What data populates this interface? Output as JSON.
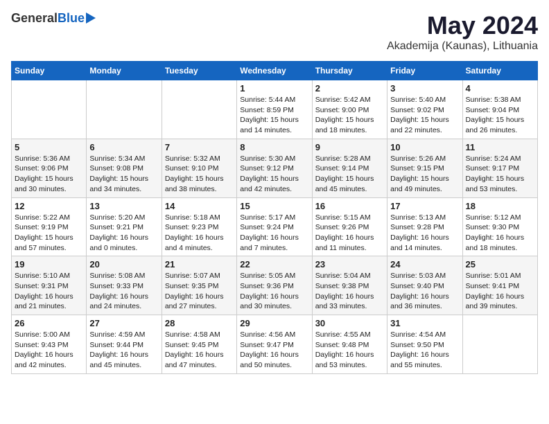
{
  "header": {
    "logo_general": "General",
    "logo_blue": "Blue",
    "month_year": "May 2024",
    "location": "Akademija (Kaunas), Lithuania"
  },
  "days_of_week": [
    "Sunday",
    "Monday",
    "Tuesday",
    "Wednesday",
    "Thursday",
    "Friday",
    "Saturday"
  ],
  "weeks": [
    [
      {
        "day": "",
        "info": ""
      },
      {
        "day": "",
        "info": ""
      },
      {
        "day": "",
        "info": ""
      },
      {
        "day": "1",
        "info": "Sunrise: 5:44 AM\nSunset: 8:59 PM\nDaylight: 15 hours\nand 14 minutes."
      },
      {
        "day": "2",
        "info": "Sunrise: 5:42 AM\nSunset: 9:00 PM\nDaylight: 15 hours\nand 18 minutes."
      },
      {
        "day": "3",
        "info": "Sunrise: 5:40 AM\nSunset: 9:02 PM\nDaylight: 15 hours\nand 22 minutes."
      },
      {
        "day": "4",
        "info": "Sunrise: 5:38 AM\nSunset: 9:04 PM\nDaylight: 15 hours\nand 26 minutes."
      }
    ],
    [
      {
        "day": "5",
        "info": "Sunrise: 5:36 AM\nSunset: 9:06 PM\nDaylight: 15 hours\nand 30 minutes."
      },
      {
        "day": "6",
        "info": "Sunrise: 5:34 AM\nSunset: 9:08 PM\nDaylight: 15 hours\nand 34 minutes."
      },
      {
        "day": "7",
        "info": "Sunrise: 5:32 AM\nSunset: 9:10 PM\nDaylight: 15 hours\nand 38 minutes."
      },
      {
        "day": "8",
        "info": "Sunrise: 5:30 AM\nSunset: 9:12 PM\nDaylight: 15 hours\nand 42 minutes."
      },
      {
        "day": "9",
        "info": "Sunrise: 5:28 AM\nSunset: 9:14 PM\nDaylight: 15 hours\nand 45 minutes."
      },
      {
        "day": "10",
        "info": "Sunrise: 5:26 AM\nSunset: 9:15 PM\nDaylight: 15 hours\nand 49 minutes."
      },
      {
        "day": "11",
        "info": "Sunrise: 5:24 AM\nSunset: 9:17 PM\nDaylight: 15 hours\nand 53 minutes."
      }
    ],
    [
      {
        "day": "12",
        "info": "Sunrise: 5:22 AM\nSunset: 9:19 PM\nDaylight: 15 hours\nand 57 minutes."
      },
      {
        "day": "13",
        "info": "Sunrise: 5:20 AM\nSunset: 9:21 PM\nDaylight: 16 hours\nand 0 minutes."
      },
      {
        "day": "14",
        "info": "Sunrise: 5:18 AM\nSunset: 9:23 PM\nDaylight: 16 hours\nand 4 minutes."
      },
      {
        "day": "15",
        "info": "Sunrise: 5:17 AM\nSunset: 9:24 PM\nDaylight: 16 hours\nand 7 minutes."
      },
      {
        "day": "16",
        "info": "Sunrise: 5:15 AM\nSunset: 9:26 PM\nDaylight: 16 hours\nand 11 minutes."
      },
      {
        "day": "17",
        "info": "Sunrise: 5:13 AM\nSunset: 9:28 PM\nDaylight: 16 hours\nand 14 minutes."
      },
      {
        "day": "18",
        "info": "Sunrise: 5:12 AM\nSunset: 9:30 PM\nDaylight: 16 hours\nand 18 minutes."
      }
    ],
    [
      {
        "day": "19",
        "info": "Sunrise: 5:10 AM\nSunset: 9:31 PM\nDaylight: 16 hours\nand 21 minutes."
      },
      {
        "day": "20",
        "info": "Sunrise: 5:08 AM\nSunset: 9:33 PM\nDaylight: 16 hours\nand 24 minutes."
      },
      {
        "day": "21",
        "info": "Sunrise: 5:07 AM\nSunset: 9:35 PM\nDaylight: 16 hours\nand 27 minutes."
      },
      {
        "day": "22",
        "info": "Sunrise: 5:05 AM\nSunset: 9:36 PM\nDaylight: 16 hours\nand 30 minutes."
      },
      {
        "day": "23",
        "info": "Sunrise: 5:04 AM\nSunset: 9:38 PM\nDaylight: 16 hours\nand 33 minutes."
      },
      {
        "day": "24",
        "info": "Sunrise: 5:03 AM\nSunset: 9:40 PM\nDaylight: 16 hours\nand 36 minutes."
      },
      {
        "day": "25",
        "info": "Sunrise: 5:01 AM\nSunset: 9:41 PM\nDaylight: 16 hours\nand 39 minutes."
      }
    ],
    [
      {
        "day": "26",
        "info": "Sunrise: 5:00 AM\nSunset: 9:43 PM\nDaylight: 16 hours\nand 42 minutes."
      },
      {
        "day": "27",
        "info": "Sunrise: 4:59 AM\nSunset: 9:44 PM\nDaylight: 16 hours\nand 45 minutes."
      },
      {
        "day": "28",
        "info": "Sunrise: 4:58 AM\nSunset: 9:45 PM\nDaylight: 16 hours\nand 47 minutes."
      },
      {
        "day": "29",
        "info": "Sunrise: 4:56 AM\nSunset: 9:47 PM\nDaylight: 16 hours\nand 50 minutes."
      },
      {
        "day": "30",
        "info": "Sunrise: 4:55 AM\nSunset: 9:48 PM\nDaylight: 16 hours\nand 53 minutes."
      },
      {
        "day": "31",
        "info": "Sunrise: 4:54 AM\nSunset: 9:50 PM\nDaylight: 16 hours\nand 55 minutes."
      },
      {
        "day": "",
        "info": ""
      }
    ]
  ]
}
